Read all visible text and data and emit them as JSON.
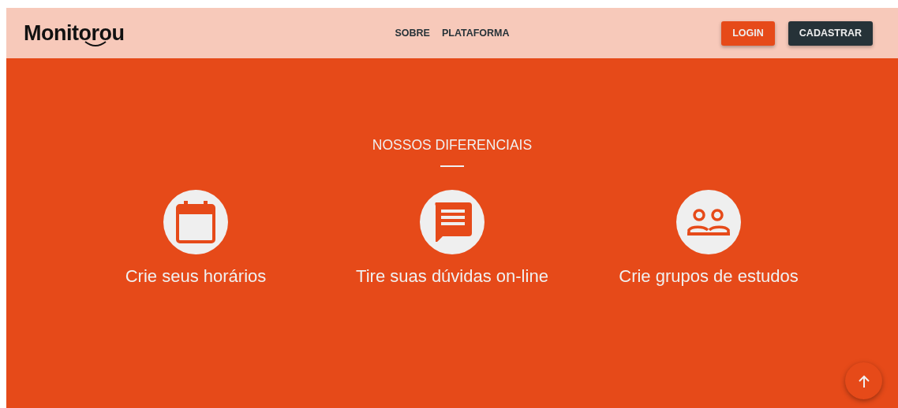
{
  "logo": {
    "before": "Monit",
    "after": "orou"
  },
  "nav": [
    "SOBRE",
    "PLATAFORMA"
  ],
  "actions": [
    {
      "label": "LOGIN",
      "kind": "primary"
    },
    {
      "label": "CADASTRAR",
      "kind": "dark"
    }
  ],
  "section": {
    "title": "NOSSOS DIFERENCIAIS",
    "features": [
      {
        "kind": "calendar",
        "label": "Crie seus horários"
      },
      {
        "kind": "chat",
        "label": "Tire suas dúvidas on-line"
      },
      {
        "kind": "group",
        "label": "Crie grupos de estudos"
      }
    ]
  }
}
